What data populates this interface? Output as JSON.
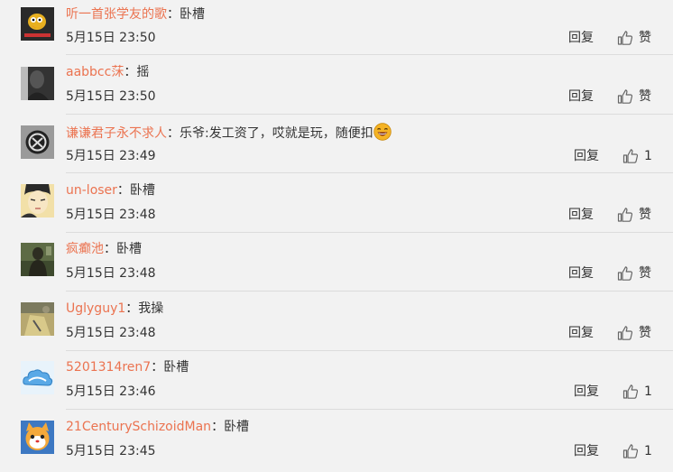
{
  "comments": [
    {
      "user": "听一首张学友的歌",
      "text": "卧槽",
      "time": "5月15日 23:50",
      "reply": "回复",
      "like": "赞",
      "avatar": "duck-cartoon-avatar"
    },
    {
      "user": "aabbcc莯",
      "text": "摇",
      "time": "5月15日 23:50",
      "reply": "回复",
      "like": "赞",
      "avatar": "dark-portrait-avatar"
    },
    {
      "user": "谦谦君子永不求人",
      "text": "乐爷:发工资了，哎就是玩，随便扣",
      "time": "5月15日 23:49",
      "reply": "回复",
      "like": "1",
      "avatar": "round-logo-avatar",
      "emoji": "laughing-face-emoji"
    },
    {
      "user": "un-loser",
      "text": "卧槽",
      "time": "5月15日 23:48",
      "reply": "回复",
      "like": "赞",
      "avatar": "anime-face-avatar"
    },
    {
      "user": "疯癫池",
      "text": "卧槽",
      "time": "5月15日 23:48",
      "reply": "回复",
      "like": "赞",
      "avatar": "green-figure-avatar"
    },
    {
      "user": "Uglyguy1",
      "text": "我操",
      "time": "5月15日 23:48",
      "reply": "回复",
      "like": "赞",
      "avatar": "yellow-scene-avatar"
    },
    {
      "user": "5201314ren7",
      "text": "卧槽",
      "time": "5月15日 23:46",
      "reply": "回复",
      "like": "1",
      "avatar": "cloud-avatar"
    },
    {
      "user": "21CenturySchizoidMan",
      "text": "卧槽",
      "time": "5月15日 23:45",
      "reply": "回复",
      "like": "1",
      "avatar": "blue-cartoon-avatar"
    }
  ],
  "punct": {
    "colon": "："
  },
  "colors": {
    "username": "#eb7350",
    "text": "#333333",
    "background": "#f2f2f2",
    "divider": "#dcdcdc"
  }
}
